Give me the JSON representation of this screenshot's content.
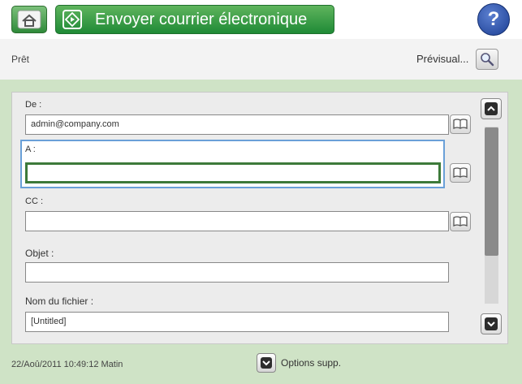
{
  "header": {
    "home_icon": "home-icon",
    "title": "Envoyer courrier électronique",
    "title_icon": "start-diamond-icon",
    "help_label": "?",
    "help_icon": "help-icon"
  },
  "status": {
    "state": "Prêt",
    "preview_label": "Prévisual...",
    "preview_icon": "magnifier-icon"
  },
  "form": {
    "from": {
      "label": "De :",
      "value": "admin@company.com"
    },
    "to": {
      "label": "A :",
      "value": ""
    },
    "cc": {
      "label": "CC :",
      "value": ""
    },
    "subject": {
      "label": "Objet :",
      "value": ""
    },
    "filename": {
      "label": "Nom du fichier :",
      "value": "[Untitled]"
    },
    "address_book_icon": "address-book-icon"
  },
  "footer": {
    "datetime": "22/Aoû/2011 10:49:12 Matin",
    "options_label": "Options supp."
  },
  "colors": {
    "title_green": "#2f8a3a",
    "help_blue": "#1c3f94",
    "background_green": "#cfe3c6",
    "focus_blue": "#6aa0d8",
    "focus_green": "#3d7a3a"
  }
}
